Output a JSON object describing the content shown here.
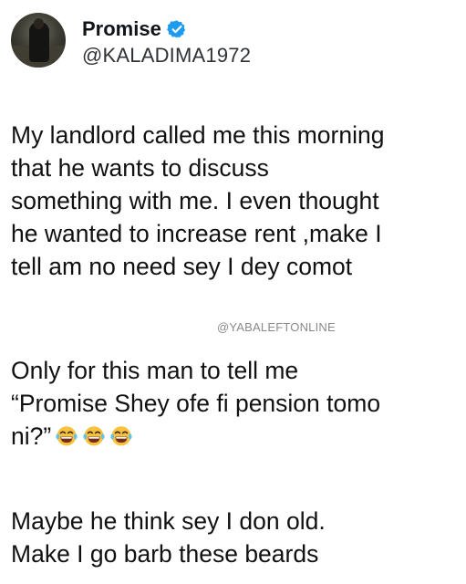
{
  "author": {
    "name": "Promise",
    "handle": "@KALADIMA1972",
    "verified": true,
    "verified_color": "#1d9bf0",
    "avatar_icon": "profile-photo"
  },
  "post": {
    "paragraph1": [
      "My landlord called me this morning",
      "that he wants to discuss",
      "something with me.  I even thought",
      "he wanted to increase rent ,make I",
      "tell am no need sey I dey comot"
    ],
    "watermark": "@YABALEFTONLINE",
    "paragraph2": [
      "Only for this man to tell me",
      "“Promise Shey ofe fi pension tomo",
      "ni?”"
    ],
    "emojis": [
      "face-with-tears-of-joy-icon",
      "face-with-tears-of-joy-icon",
      "face-with-tears-of-joy-icon"
    ],
    "paragraph3": [
      "Maybe he think sey I don old.",
      "Make I go barb these beards"
    ]
  }
}
